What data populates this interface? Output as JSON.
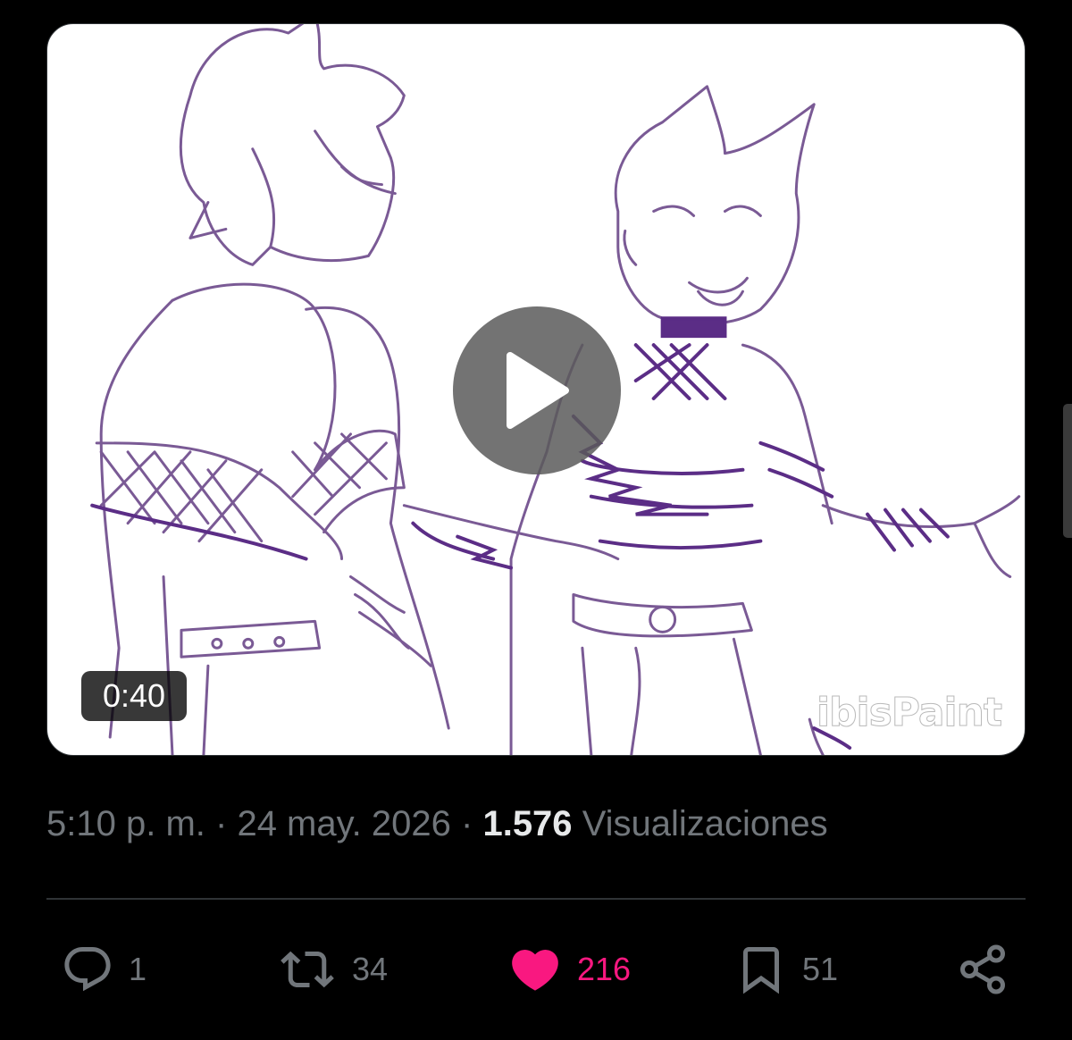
{
  "video": {
    "duration": "0:40",
    "watermark": "ibisPaint",
    "play_icon": "play-icon"
  },
  "tweet_meta": {
    "time": "5:10 p. m.",
    "date": "24 may. 2026",
    "separator": "·",
    "views_count": "1.576",
    "views_label": "Visualizaciones"
  },
  "actions": {
    "reply": {
      "icon": "reply-icon",
      "count": "1"
    },
    "retweet": {
      "icon": "retweet-icon",
      "count": "34"
    },
    "like": {
      "icon": "heart-icon",
      "count": "216",
      "liked": true
    },
    "bookmark": {
      "icon": "bookmark-icon",
      "count": "51"
    },
    "share": {
      "icon": "share-icon"
    }
  },
  "colors": {
    "background": "#000000",
    "muted_text": "#71767b",
    "primary_text": "#e7e9ea",
    "like_pink": "#f91880",
    "line_art": "#7a5a95",
    "accent_purple": "#5b2d86"
  }
}
